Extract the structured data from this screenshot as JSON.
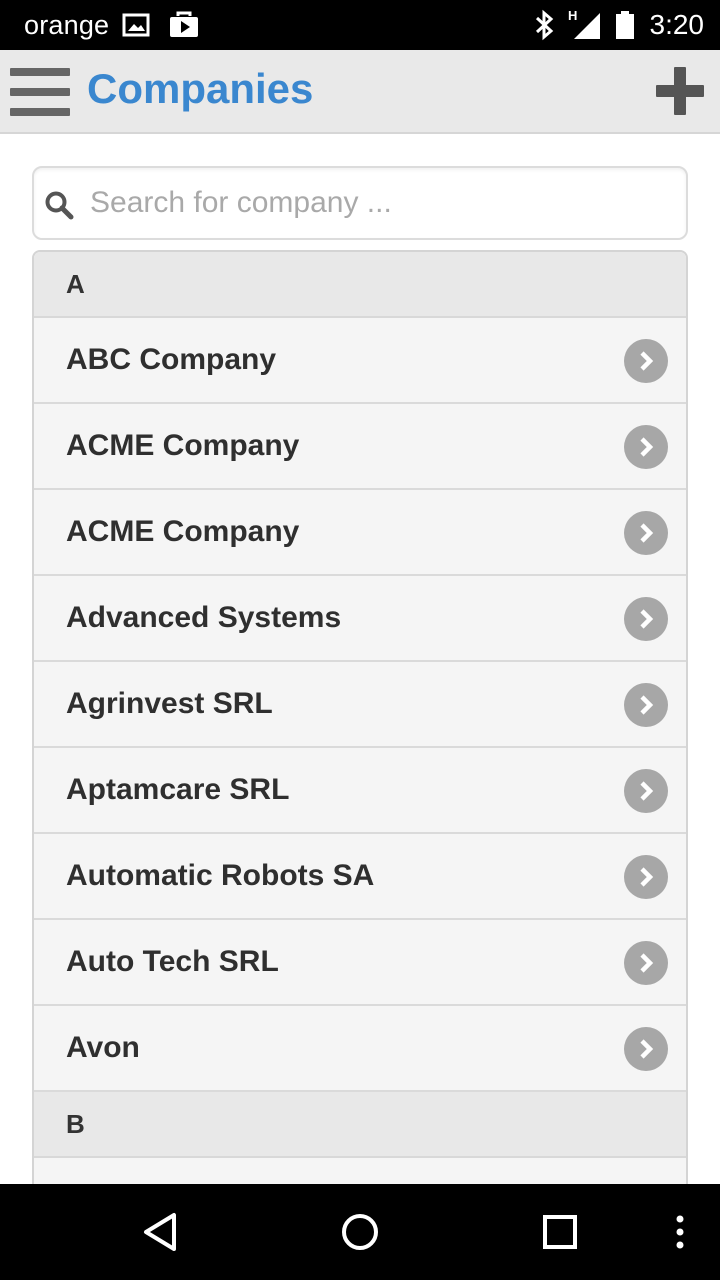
{
  "status_bar": {
    "carrier": "orange",
    "time": "3:20",
    "network_type": "H",
    "icons": [
      "image-icon",
      "shopping-bag-icon",
      "bluetooth-icon",
      "signal-icon",
      "battery-icon"
    ]
  },
  "header": {
    "title": "Companies",
    "menu_icon": "hamburger-menu-icon",
    "add_icon": "plus-icon",
    "title_color": "#3a87cf"
  },
  "search": {
    "placeholder": "Search for company ...",
    "value": ""
  },
  "list": {
    "sections": [
      {
        "letter": "A",
        "items": [
          "ABC Company",
          "ACME Company",
          "ACME Company",
          "Advanced Systems",
          "Agrinvest SRL",
          "Aptamcare SRL",
          "Automatic Robots SA",
          "Auto Tech SRL",
          "Avon"
        ]
      },
      {
        "letter": "B",
        "items": []
      }
    ]
  },
  "nav_bar": {
    "icons": [
      "back-icon",
      "home-icon",
      "recents-icon",
      "overflow-menu-icon"
    ]
  }
}
